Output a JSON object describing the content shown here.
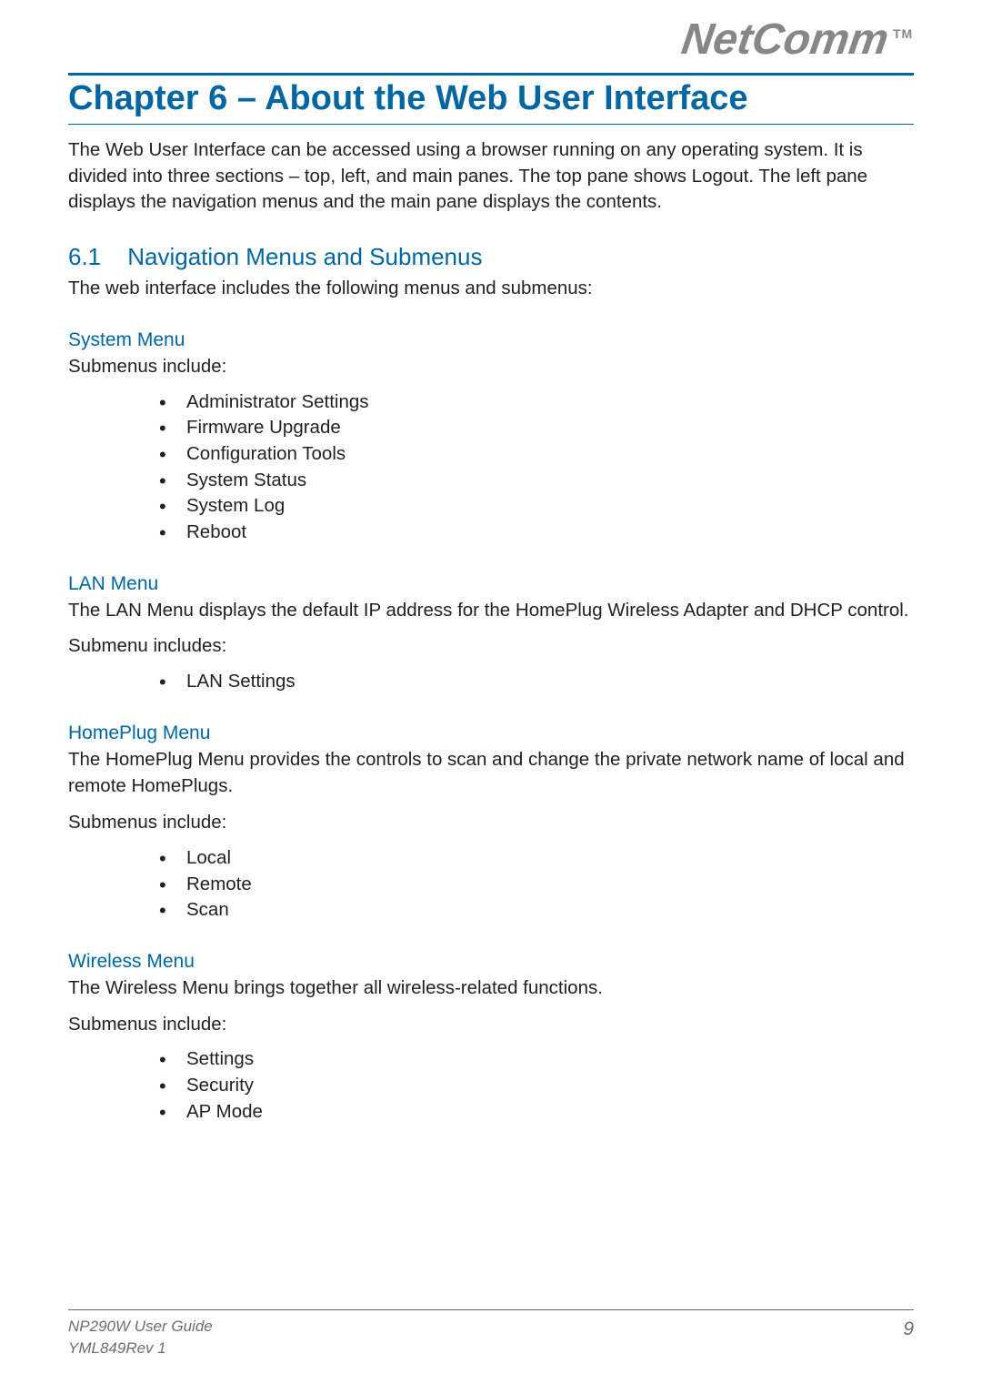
{
  "brand": {
    "name": "NetComm",
    "tm": "TM"
  },
  "chapter": {
    "title": "Chapter 6 – About the Web User Interface"
  },
  "intro": "The Web User Interface can be accessed using a browser running on any operating system. It is divided into three sections – top, left, and main panes. The top pane shows Logout. The left pane displays the navigation menus and the main pane displays the contents.",
  "section": {
    "number": "6.1",
    "title": "Navigation Menus and Submenus",
    "intro": "The web interface includes the following menus and submenus:"
  },
  "menus": {
    "system": {
      "heading": "System Menu",
      "lead": "Submenus include:",
      "items": [
        "Administrator Settings",
        "Firmware Upgrade",
        "Configuration Tools",
        "System Status",
        "System Log",
        "Reboot"
      ]
    },
    "lan": {
      "heading": "LAN Menu",
      "desc": "The LAN Menu displays the default IP address for the HomePlug Wireless Adapter and DHCP control.",
      "lead": "Submenu includes:",
      "items": [
        "LAN Settings"
      ]
    },
    "homeplug": {
      "heading": "HomePlug Menu",
      "desc": "The HomePlug Menu provides the controls to scan and change the private network name of local and remote HomePlugs.",
      "lead": "Submenus include:",
      "items": [
        "Local",
        "Remote",
        "Scan"
      ]
    },
    "wireless": {
      "heading": "Wireless Menu",
      "desc": "The Wireless Menu brings together all wireless-related functions.",
      "lead": "Submenus include:",
      "items": [
        "Settings",
        "Security",
        "AP Mode"
      ]
    }
  },
  "footer": {
    "line1": "NP290W User Guide",
    "line2": "YML849Rev 1",
    "page": "9"
  }
}
